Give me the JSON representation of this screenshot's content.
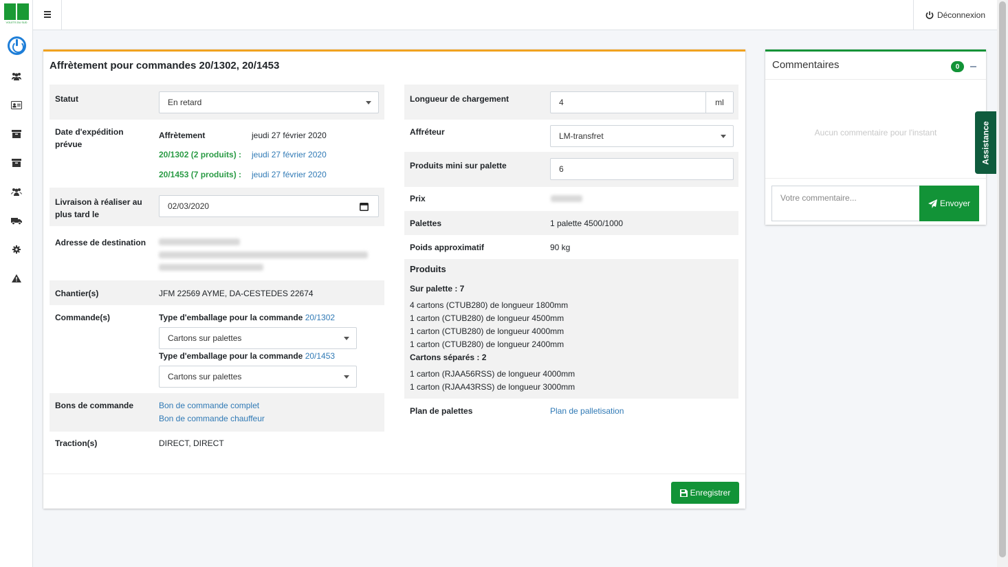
{
  "topbar": {
    "logout_label": "Déconnexion"
  },
  "logo": {
    "text": "VOLETS DU SUD"
  },
  "page": {
    "title": "Affrètement pour commandes 20/1302, 20/1453"
  },
  "left": {
    "statut": {
      "label": "Statut",
      "value": "En retard"
    },
    "date_exp": {
      "label": "Date d'expédition prévue",
      "affretement_label": "Affrètement",
      "affretement_value": "jeudi 27 février 2020",
      "order1_label": "20/1302 (2 produits) :",
      "order1_value": "jeudi 27 février 2020",
      "order2_label": "20/1453 (7 produits) :",
      "order2_value": "jeudi 27 février 2020"
    },
    "livraison": {
      "label": "Livraison à réaliser au plus tard le",
      "value": "02/03/2020"
    },
    "adresse": {
      "label": "Adresse de destination"
    },
    "chantier": {
      "label": "Chantier(s)",
      "value": "JFM 22569 AYME, DA-CESTEDES 22674"
    },
    "commandes": {
      "label": "Commande(s)",
      "type1_prefix": "Type d'emballage pour la commande ",
      "type1_link": "20/1302",
      "type1_value": "Cartons sur palettes",
      "type2_prefix": "Type d'emballage pour la commande ",
      "type2_link": "20/1453",
      "type2_value": "Cartons sur palettes"
    },
    "bons": {
      "label": "Bons de commande",
      "link1": "Bon de commande complet",
      "link2": "Bon de commande chauffeur"
    },
    "traction": {
      "label": "Traction(s)",
      "value": "DIRECT, DIRECT"
    }
  },
  "right": {
    "longueur": {
      "label": "Longueur de chargement",
      "value": "4",
      "unit": "ml"
    },
    "affreteur": {
      "label": "Affréteur",
      "value": "LM-transfret"
    },
    "produits_mini": {
      "label": "Produits mini sur palette",
      "value": "6"
    },
    "prix": {
      "label": "Prix"
    },
    "palettes": {
      "label": "Palettes",
      "value": "1 palette 4500/1000"
    },
    "poids": {
      "label": "Poids approximatif",
      "value": "90 kg"
    },
    "produits": {
      "label": "Produits",
      "sur_palette": "Sur palette : 7",
      "palette_items": [
        "4 cartons (CTUB280) de longueur 1800mm",
        "1 carton (CTUB280) de longueur 4500mm",
        "1 carton (CTUB280) de longueur 4000mm",
        "1 carton (CTUB280) de longueur 2400mm"
      ],
      "separes": "Cartons séparés : 2",
      "separes_items": [
        "1 carton (RJAA56RSS) de longueur 4000mm",
        "1 carton (RJAA43RSS) de longueur 3000mm"
      ]
    },
    "plan": {
      "label": "Plan de palettes",
      "link": "Plan de palletisation"
    }
  },
  "footer": {
    "save_label": "Enregistrer"
  },
  "comments": {
    "title": "Commentaires",
    "count": "0",
    "empty": "Aucun commentaire pour l'instant",
    "placeholder": "Votre commentaire...",
    "send_label": "Envoyer"
  },
  "assist": {
    "label": "Assistance"
  },
  "colors": {
    "accent_orange": "#f0a21f",
    "brand_green": "#129337",
    "link_blue": "#2f79b5"
  }
}
